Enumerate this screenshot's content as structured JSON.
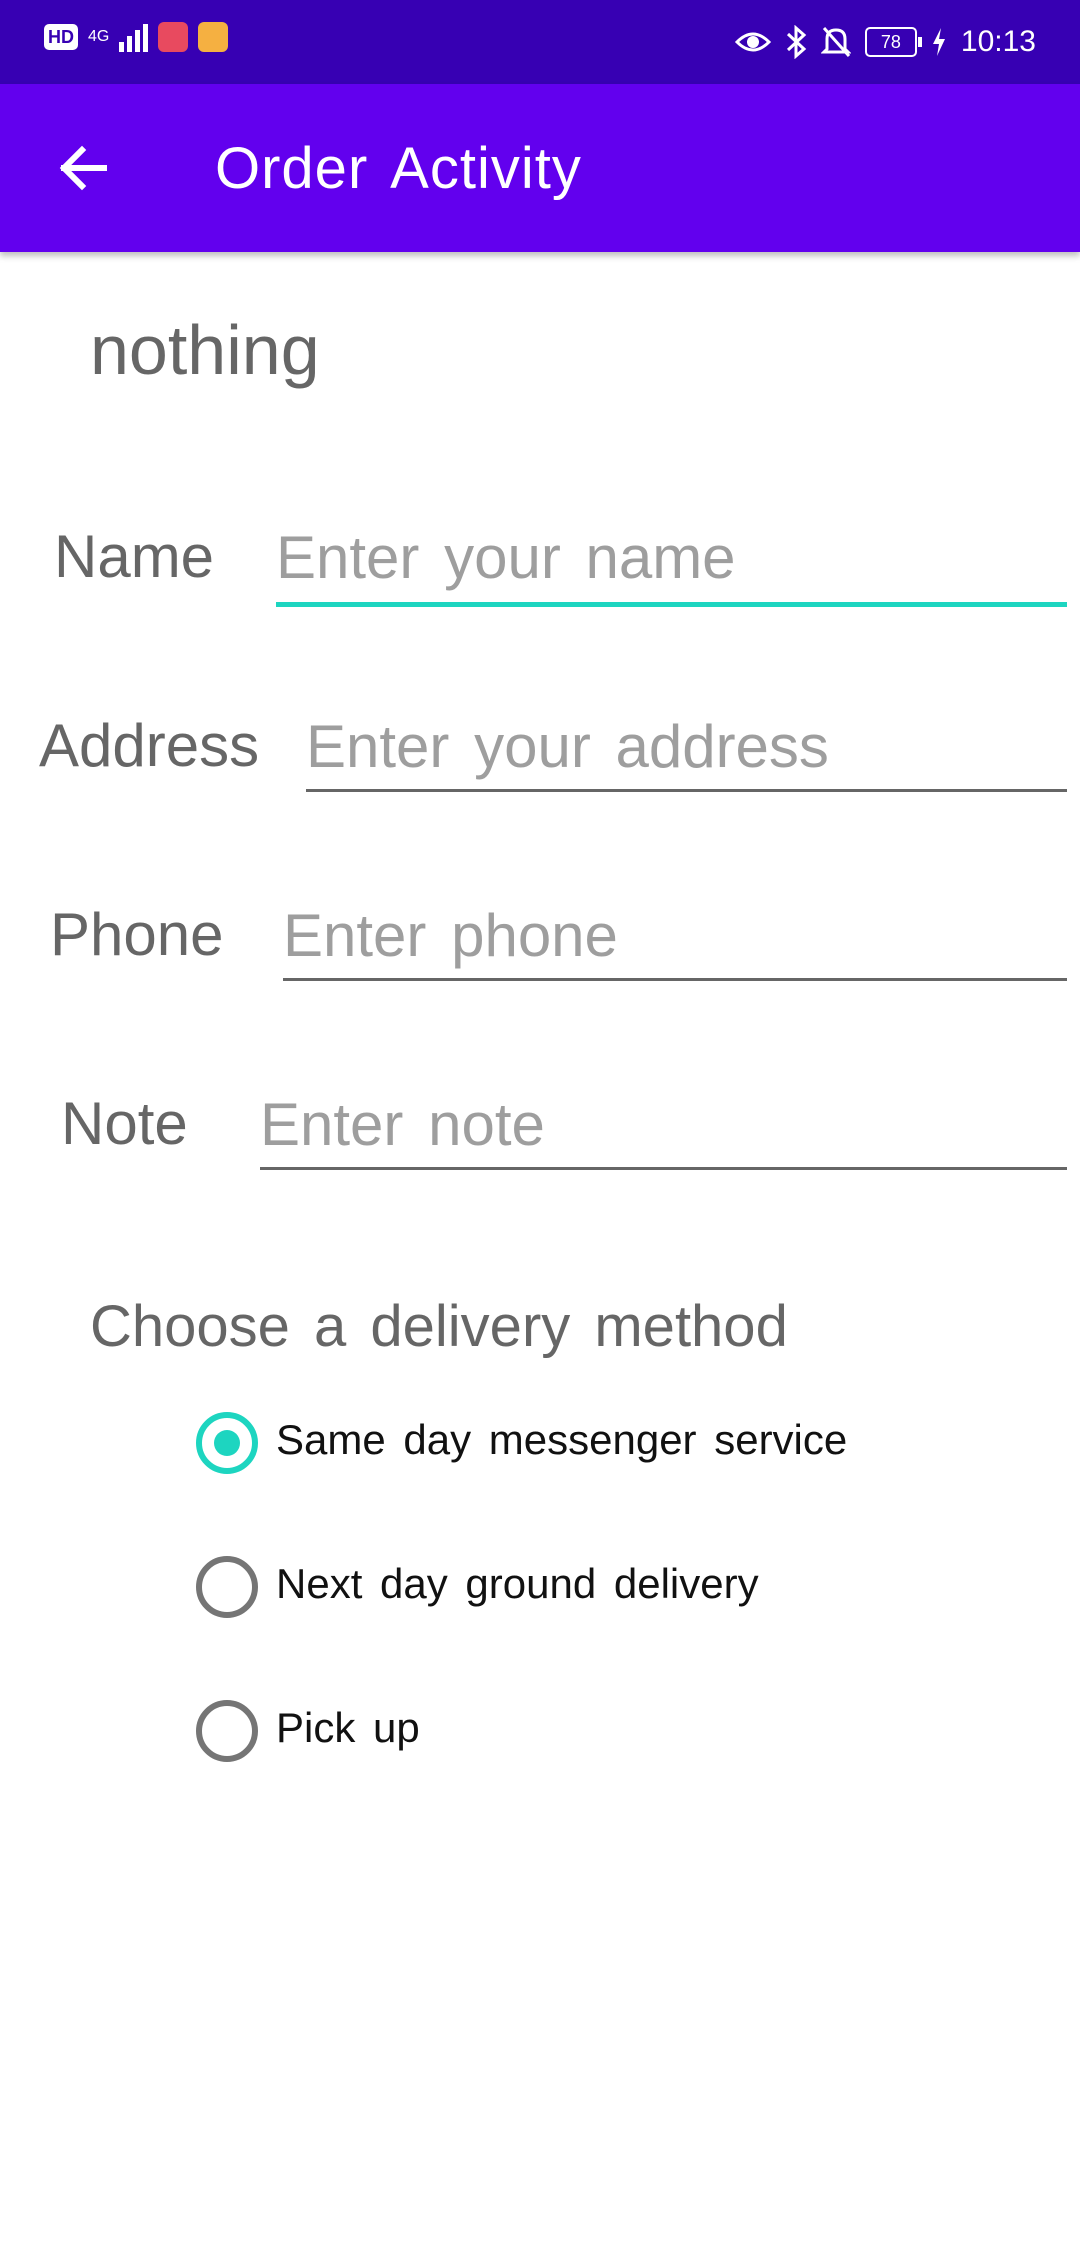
{
  "status_bar": {
    "network_badge": "HD",
    "network_type": "4G",
    "battery": "78",
    "time": "10:13",
    "icons": [
      "hd-icon",
      "signal-icon",
      "book-app-icon",
      "cup-app-icon",
      "eye-icon",
      "bluetooth-icon",
      "mute-icon",
      "battery-icon",
      "charging-icon"
    ]
  },
  "app_bar": {
    "title": "Order Activity",
    "back_icon": "arrow-left-icon"
  },
  "header": {
    "text": "nothing"
  },
  "form": {
    "name": {
      "label": "Name",
      "placeholder": "Enter your name",
      "value": ""
    },
    "address": {
      "label": "Address",
      "placeholder": "Enter your address",
      "value": ""
    },
    "phone": {
      "label": "Phone",
      "placeholder": "Enter phone",
      "value": ""
    },
    "note": {
      "label": "Note",
      "placeholder": "Enter note",
      "value": ""
    }
  },
  "delivery": {
    "prompt": "Choose a delivery method",
    "options": [
      {
        "label": "Same day messenger service",
        "checked": true
      },
      {
        "label": "Next day ground delivery",
        "checked": false
      },
      {
        "label": "Pick up",
        "checked": false
      }
    ]
  },
  "colors": {
    "status_bar": "#3700b3",
    "app_bar": "#6200ee",
    "accent": "#1dd5c0",
    "label_text": "#666666",
    "hint_text": "#9e9e9e"
  }
}
